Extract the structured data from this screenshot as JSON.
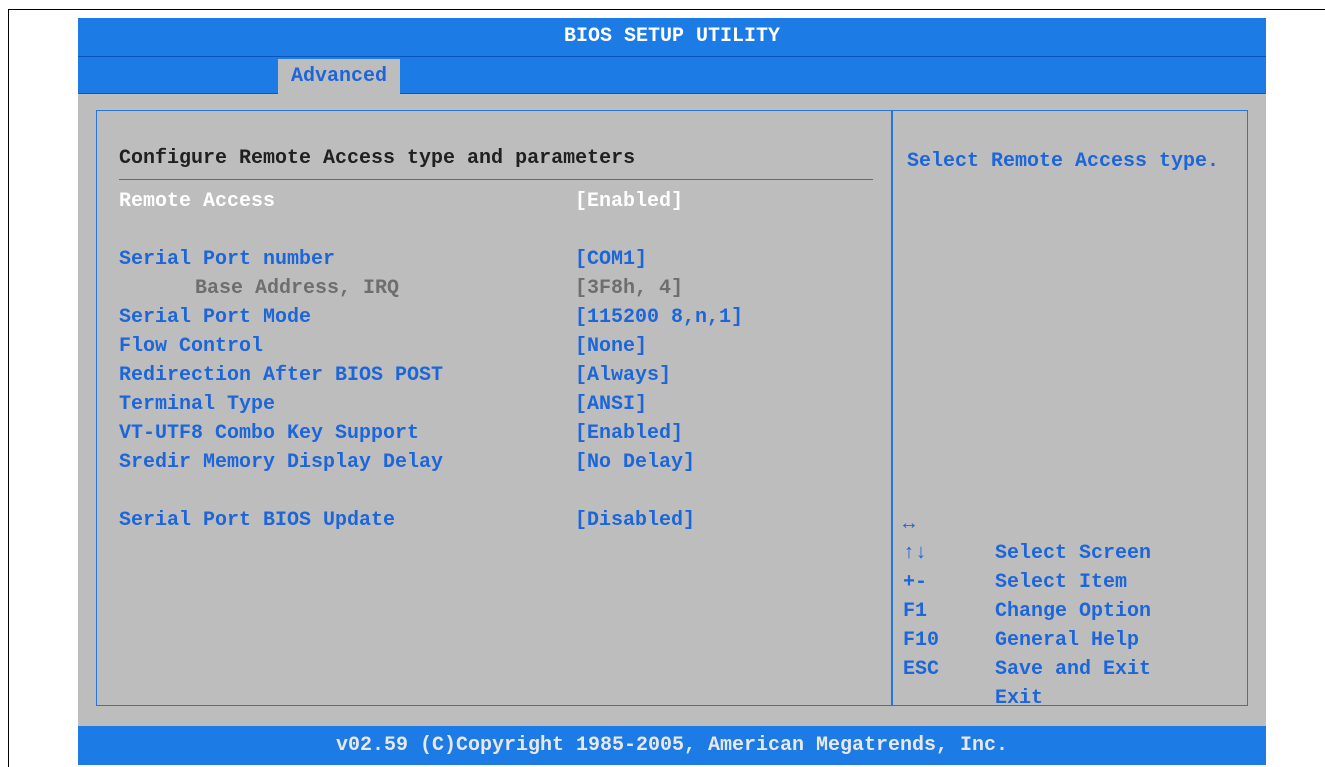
{
  "window": {
    "title": "BIOS SETUP UTILITY"
  },
  "tabs": [
    {
      "label": "Advanced",
      "active": true
    }
  ],
  "main": {
    "section_title": "Configure Remote Access type and parameters",
    "settings": [
      {
        "label": "Remote Access",
        "value": "[Enabled]",
        "state": "selected"
      },
      {
        "label": "Serial Port number",
        "value": "[COM1]",
        "state": "normal"
      },
      {
        "label": "Base Address, IRQ",
        "value": "[3F8h, 4]",
        "state": "disabled"
      },
      {
        "label": "Serial Port Mode",
        "value": "[115200 8,n,1]",
        "state": "normal"
      },
      {
        "label": "Flow Control",
        "value": "[None]",
        "state": "normal"
      },
      {
        "label": "Redirection After BIOS POST",
        "value": "[Always]",
        "state": "normal"
      },
      {
        "label": "Terminal Type",
        "value": "[ANSI]",
        "state": "normal"
      },
      {
        "label": "VT-UTF8 Combo Key Support",
        "value": "[Enabled]",
        "state": "normal"
      },
      {
        "label": "Sredir Memory Display Delay",
        "value": "[No Delay]",
        "state": "normal"
      },
      {
        "label": "Serial Port BIOS Update",
        "value": "[Disabled]",
        "state": "normal"
      }
    ]
  },
  "help": {
    "text": "Select Remote Access type.",
    "keys": [
      {
        "key": "↔",
        "desc": "Select Screen",
        "icon": "left-right-arrow-icon"
      },
      {
        "key": "↑↓",
        "desc": "Select Item",
        "icon": "up-down-arrow-icon"
      },
      {
        "key": "+-",
        "desc": "Change Option"
      },
      {
        "key": "F1",
        "desc": "General Help"
      },
      {
        "key": "F10",
        "desc": "Save and Exit"
      },
      {
        "key": "ESC",
        "desc": "Exit"
      }
    ]
  },
  "footer": {
    "text": "v02.59 (C)Copyright 1985-2005, American Megatrends, Inc."
  },
  "colors": {
    "accent": "#1d7be6",
    "background": "#bdbdbd",
    "option_text": "#1d66d9",
    "selected_text": "#ffffff",
    "disabled_text": "#6e6e6e"
  }
}
